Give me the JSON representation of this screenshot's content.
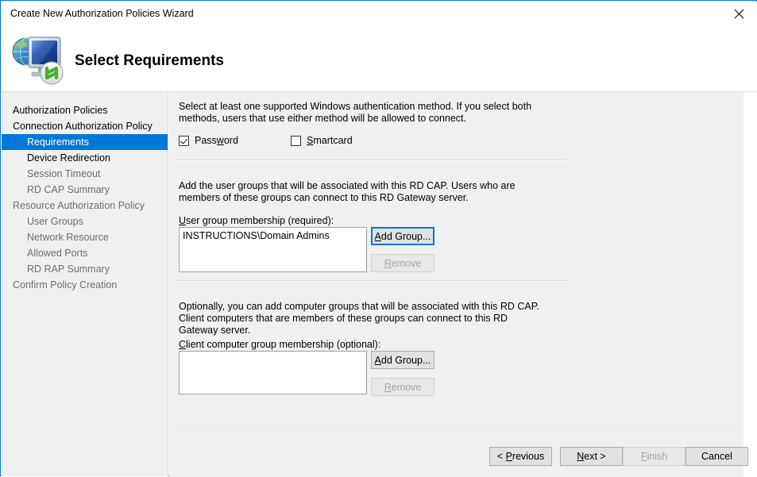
{
  "window": {
    "title": "Create New Authorization Policies Wizard",
    "close_icon": "close-icon",
    "border_color": "#0078d7"
  },
  "header": {
    "title": "Select Requirements",
    "icon": "rd-gateway-icon"
  },
  "sidebar": {
    "items": [
      {
        "label": "Authorization Policies",
        "level": 0,
        "state": "done"
      },
      {
        "label": "Connection Authorization Policy",
        "level": 0,
        "state": "done"
      },
      {
        "label": "Requirements",
        "level": 1,
        "state": "selected"
      },
      {
        "label": "Device Redirection",
        "level": 1,
        "state": "done"
      },
      {
        "label": "Session Timeout",
        "level": 1,
        "state": "pending"
      },
      {
        "label": "RD CAP Summary",
        "level": 1,
        "state": "pending"
      },
      {
        "label": "Resource Authorization Policy",
        "level": 0,
        "state": "pending"
      },
      {
        "label": "User Groups",
        "level": 1,
        "state": "pending"
      },
      {
        "label": "Network Resource",
        "level": 1,
        "state": "pending"
      },
      {
        "label": "Allowed Ports",
        "level": 1,
        "state": "pending"
      },
      {
        "label": "RD RAP Summary",
        "level": 1,
        "state": "pending"
      },
      {
        "label": "Confirm Policy Creation",
        "level": 0,
        "state": "pending"
      }
    ],
    "selected_color": "#0078d7"
  },
  "main": {
    "intro_text": "Select at least one supported Windows authentication method. If you select both methods, users that use either method will be allowed to connect.",
    "auth_methods": [
      {
        "label": "Password",
        "accel": "w",
        "checked": true
      },
      {
        "label": "Smartcard",
        "accel": "S",
        "checked": false
      }
    ],
    "user_section": {
      "description": "Add the user groups that will be associated with this RD CAP. Users who are members of these groups can connect to this RD Gateway server.",
      "label": "User group membership (required):",
      "label_accel": "U",
      "items": [
        "INSTRUCTIONS\\Domain Admins"
      ],
      "add_button": "Add Group...",
      "add_accel": "A",
      "add_focused": true,
      "remove_button": "Remove",
      "remove_accel": "R",
      "remove_disabled": true
    },
    "client_section": {
      "description": "Optionally, you can add computer groups that will be associated with this RD CAP. Client computers that are members of these groups can connect to this RD Gateway server.",
      "label": "Client computer group membership (optional):",
      "label_accel": "C",
      "items": [],
      "add_button": "Add Group...",
      "add_accel": "A",
      "add_focused": false,
      "remove_button": "Remove",
      "remove_accel": "R",
      "remove_disabled": true
    }
  },
  "footer": {
    "previous": "< Previous",
    "previous_accel": "P",
    "next": "Next >",
    "next_accel": "N",
    "finish": "Finish",
    "finish_accel": "F",
    "finish_disabled": true,
    "cancel": "Cancel"
  }
}
